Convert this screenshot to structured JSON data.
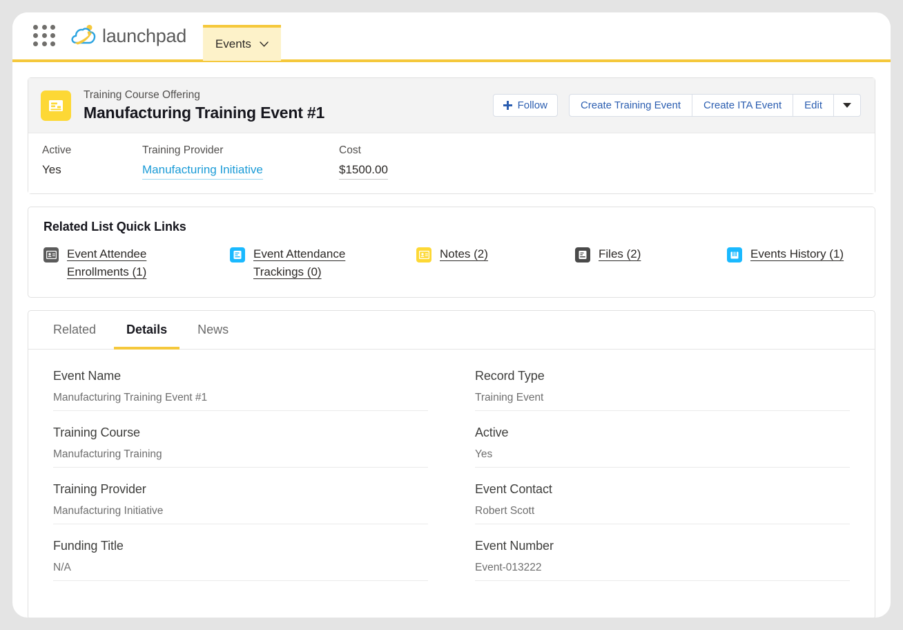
{
  "globalnav": {
    "app_launcher_icon": "app-launcher-grid-icon",
    "brand_name": "launchpad",
    "brand_logo_icon": "launchpad-cloud-logo",
    "tab": {
      "label": "Events",
      "caret_icon": "chevron-down-icon"
    }
  },
  "record_header": {
    "icon": "record-form-icon",
    "object_label": "Training Course Offering",
    "record_title": "Manufacturing Training Event #1",
    "actions": {
      "follow": {
        "label": "Follow",
        "icon": "plus-icon"
      },
      "create_training_event": "Create Training Event",
      "create_ita_event": "Create ITA Event",
      "edit": "Edit",
      "more_caret_icon": "caret-down-icon"
    },
    "highlight_fields": [
      {
        "label": "Active",
        "value": "Yes",
        "style": "plain"
      },
      {
        "label": "Training Provider",
        "value": "Manufacturing Initiative",
        "style": "link"
      },
      {
        "label": "Cost",
        "value": "$1500.00",
        "style": "underlined"
      }
    ]
  },
  "quick_links": {
    "title": "Related List Quick Links",
    "items": [
      {
        "label": "Event Attendee Enrollments (1)",
        "icon": "contact-card-icon",
        "icon_color": "gray"
      },
      {
        "label": "Event Attendance Trackings (0)",
        "icon": "document-icon",
        "icon_color": "blue"
      },
      {
        "label": "Notes (2)",
        "icon": "note-card-icon",
        "icon_color": "yellow"
      },
      {
        "label": "Files (2)",
        "icon": "file-icon",
        "icon_color": "darkgray"
      },
      {
        "label": "Events History (1)",
        "icon": "history-book-icon",
        "icon_color": "blue"
      }
    ]
  },
  "tabs": [
    {
      "label": "Related",
      "active": false
    },
    {
      "label": "Details",
      "active": true
    },
    {
      "label": "News",
      "active": false
    }
  ],
  "details": {
    "left": [
      {
        "label": "Event Name",
        "value": "Manufacturing Training Event #1"
      },
      {
        "label": "Training Course",
        "value": "Manufacturing Training"
      },
      {
        "label": "Training Provider",
        "value": "Manufacturing Initiative"
      },
      {
        "label": "Funding Title",
        "value": "N/A"
      }
    ],
    "right": [
      {
        "label": "Record Type",
        "value": "Training Event"
      },
      {
        "label": "Active",
        "value": "Yes"
      },
      {
        "label": "Event Contact",
        "value": "Robert Scott"
      },
      {
        "label": "Event Number",
        "value": "Event-013222"
      }
    ]
  },
  "colors": {
    "brand_yellow": "#f5c83c",
    "tab_bg": "#fdf2c9",
    "link_blue": "#2a5db0",
    "highlight_link_blue": "#1a9bd7",
    "icon_yellow": "#fdd835",
    "icon_blue": "#1ab9ff",
    "page_backdrop": "#e4e4e4"
  }
}
